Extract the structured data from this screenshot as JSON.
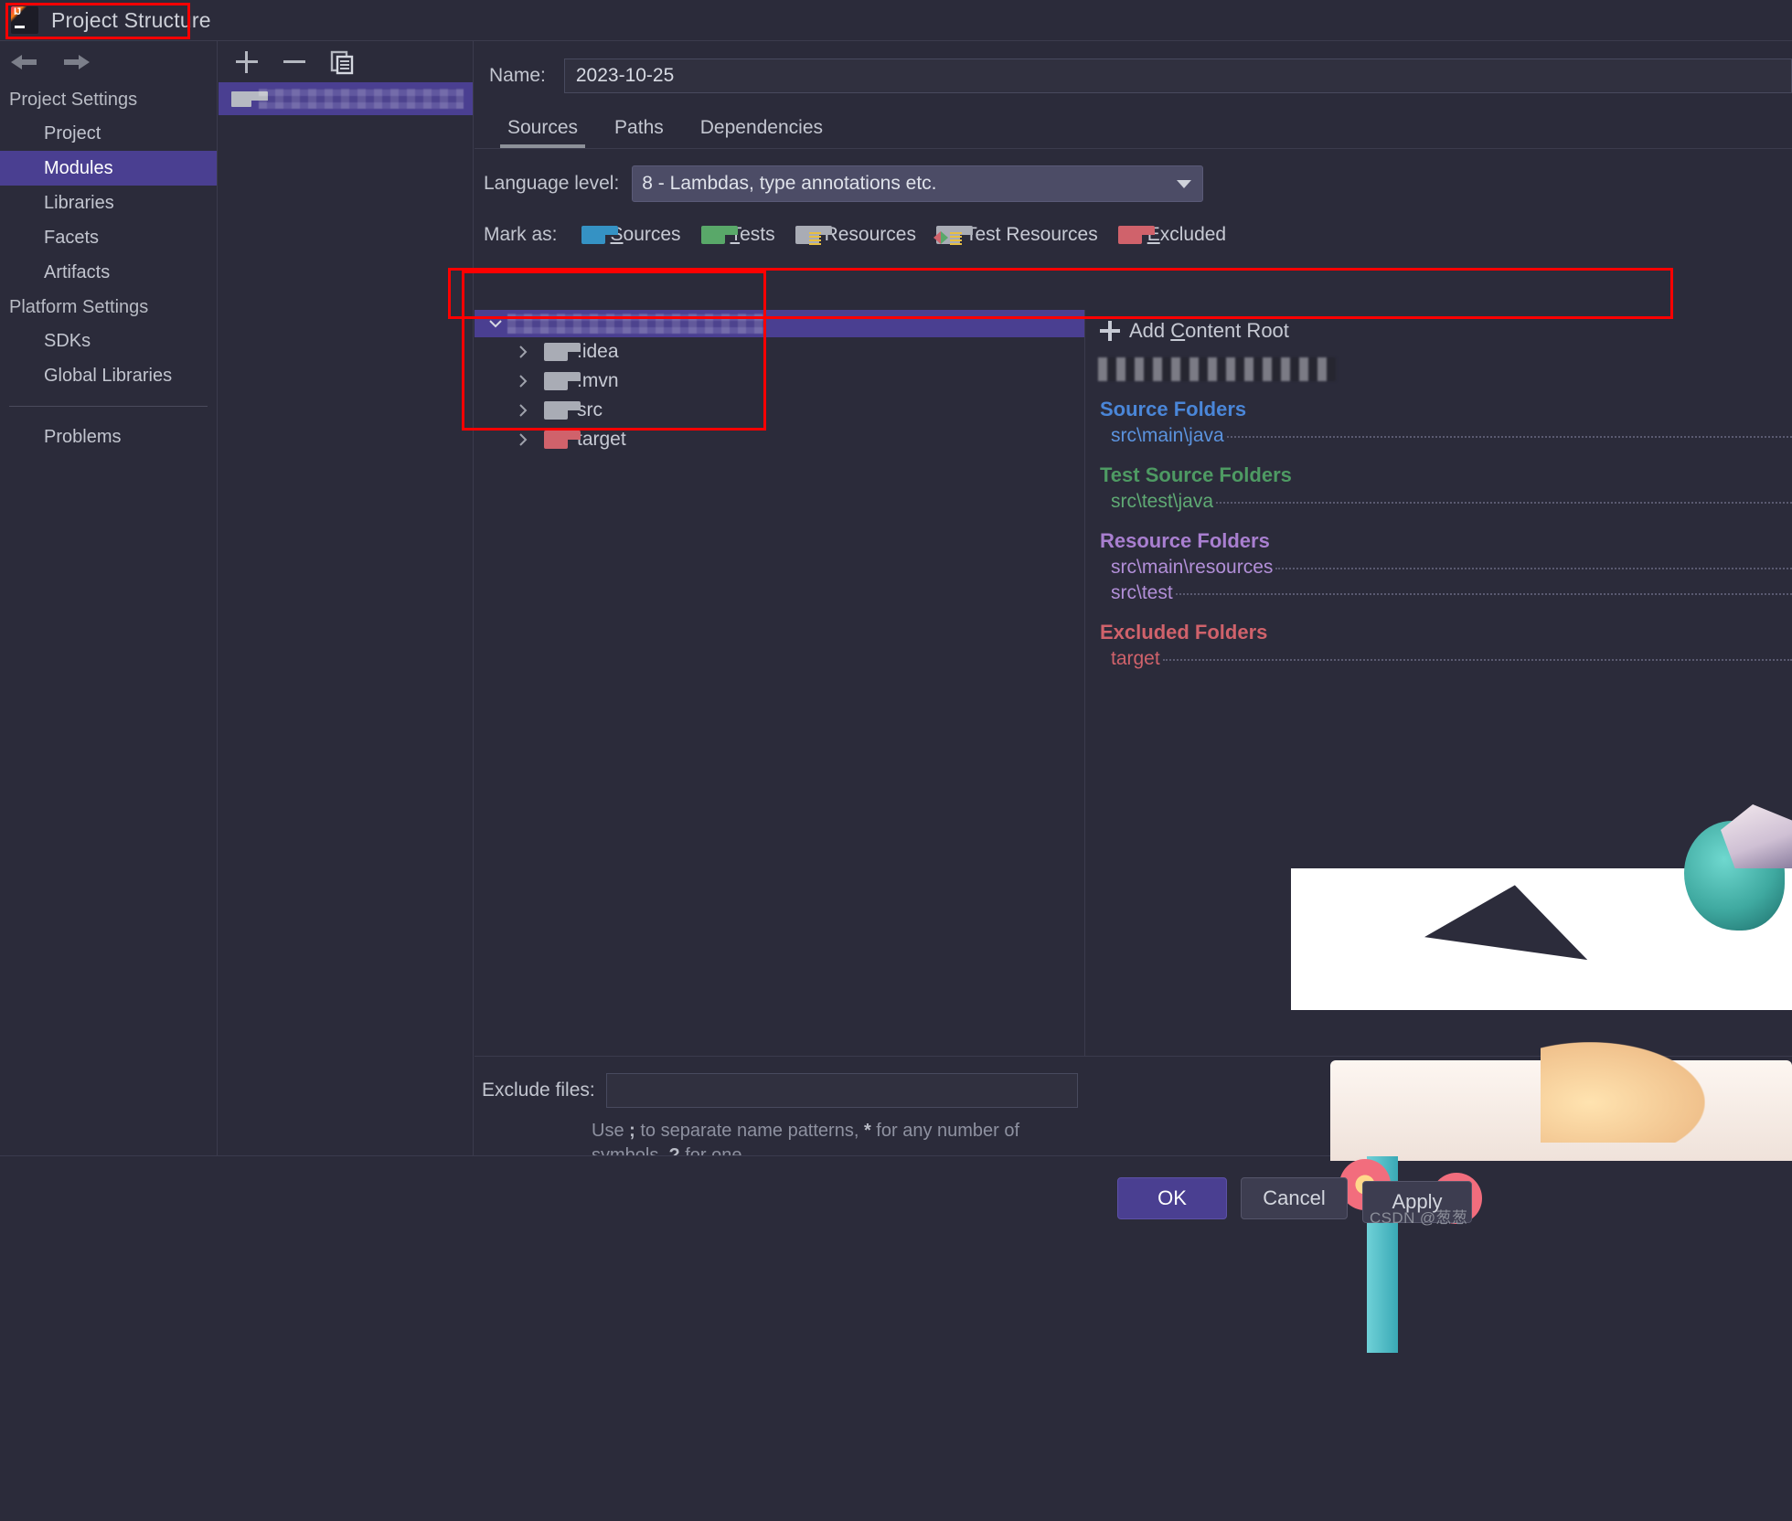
{
  "window": {
    "title": "Project Structure",
    "app_icon": "intellij-idea-icon"
  },
  "nav": {
    "back_icon": "arrow-left-icon",
    "forward_icon": "arrow-right-icon"
  },
  "sidebar": {
    "groups": [
      {
        "label": "Project Settings",
        "items": [
          {
            "label": "Project",
            "selected": false
          },
          {
            "label": "Modules",
            "selected": true
          },
          {
            "label": "Libraries",
            "selected": false
          },
          {
            "label": "Facets",
            "selected": false
          },
          {
            "label": "Artifacts",
            "selected": false
          }
        ]
      },
      {
        "label": "Platform Settings",
        "items": [
          {
            "label": "SDKs",
            "selected": false
          },
          {
            "label": "Global Libraries",
            "selected": false
          }
        ]
      }
    ],
    "problems_label": "Problems",
    "help_label": "?"
  },
  "module_list": {
    "toolbar": {
      "add_icon": "plus-icon",
      "remove_icon": "minus-icon",
      "copy_icon": "copy-icon"
    },
    "items": [
      {
        "name_visible": "2",
        "redacted": true,
        "selected": true
      }
    ]
  },
  "module_editor": {
    "name_label": "Name:",
    "name_value": "2023-10-25",
    "tabs": [
      {
        "label": "Sources",
        "active": true
      },
      {
        "label": "Paths",
        "active": false
      },
      {
        "label": "Dependencies",
        "active": false
      }
    ],
    "language_level": {
      "label": "Language level:",
      "value": "8 - Lambdas, type annotations etc.",
      "caret_icon": "chevron-down-icon"
    },
    "mark_as": {
      "label": "Mark as:",
      "options": [
        {
          "label": "Sources",
          "mnemonic": "S",
          "icon": "folder-blue-icon",
          "color": "#3592c4"
        },
        {
          "label": "Tests",
          "mnemonic": "T",
          "icon": "folder-green-icon",
          "color": "#59a869"
        },
        {
          "label": "Resources",
          "mnemonic": "R",
          "icon": "folder-resources-icon",
          "color": "#a9acb5"
        },
        {
          "label": "Test Resources",
          "mnemonic": "",
          "icon": "folder-test-resources-icon",
          "color": "#a9acb5"
        },
        {
          "label": "Excluded",
          "mnemonic": "E",
          "icon": "folder-red-icon",
          "color": "#d0626b"
        }
      ]
    },
    "tree": {
      "root": {
        "label_redacted": true,
        "expanded": true,
        "selected": true,
        "icon": "folder-icon"
      },
      "children": [
        {
          "label": ".idea",
          "icon": "folder-gray-icon",
          "color": "#a9acb5",
          "expandable": true
        },
        {
          "label": ".mvn",
          "icon": "folder-gray-icon",
          "color": "#a9acb5",
          "expandable": true
        },
        {
          "label": "src",
          "icon": "folder-gray-icon",
          "color": "#a9acb5",
          "expandable": true
        },
        {
          "label": "target",
          "icon": "folder-red-icon",
          "color": "#d0626b",
          "expandable": true
        }
      ]
    },
    "content_root": {
      "add_label": "Add Content Root",
      "add_mnemonic": "C",
      "add_icon": "plus-icon",
      "path_redacted": true,
      "groups": [
        {
          "title": "Source Folders",
          "color": "#4a86d8",
          "kind": "src",
          "items": [
            "src\\main\\java"
          ]
        },
        {
          "title": "Test Source Folders",
          "color": "#4e9a63",
          "kind": "test",
          "items": [
            "src\\test\\java"
          ]
        },
        {
          "title": "Resource Folders",
          "color": "#a97fd0",
          "kind": "res",
          "items": [
            "src\\main\\resources",
            "src\\test"
          ]
        },
        {
          "title": "Excluded Folders",
          "color": "#d0626b",
          "kind": "exc",
          "items": [
            "target"
          ]
        }
      ]
    },
    "exclude_files": {
      "label": "Exclude files:",
      "value": "",
      "hint_line1_pre": "Use ",
      "hint_semicolon": ";",
      "hint_line1_mid": " to separate name patterns, ",
      "hint_star": "*",
      "hint_line1_post": " for any number of",
      "hint_line2_pre": "symbols, ",
      "hint_question": "?",
      "hint_line2_post": " for one."
    }
  },
  "dialog_buttons": {
    "ok": "OK",
    "cancel": "Cancel",
    "apply": "Apply"
  },
  "watermark": "CSDN @葱葱"
}
